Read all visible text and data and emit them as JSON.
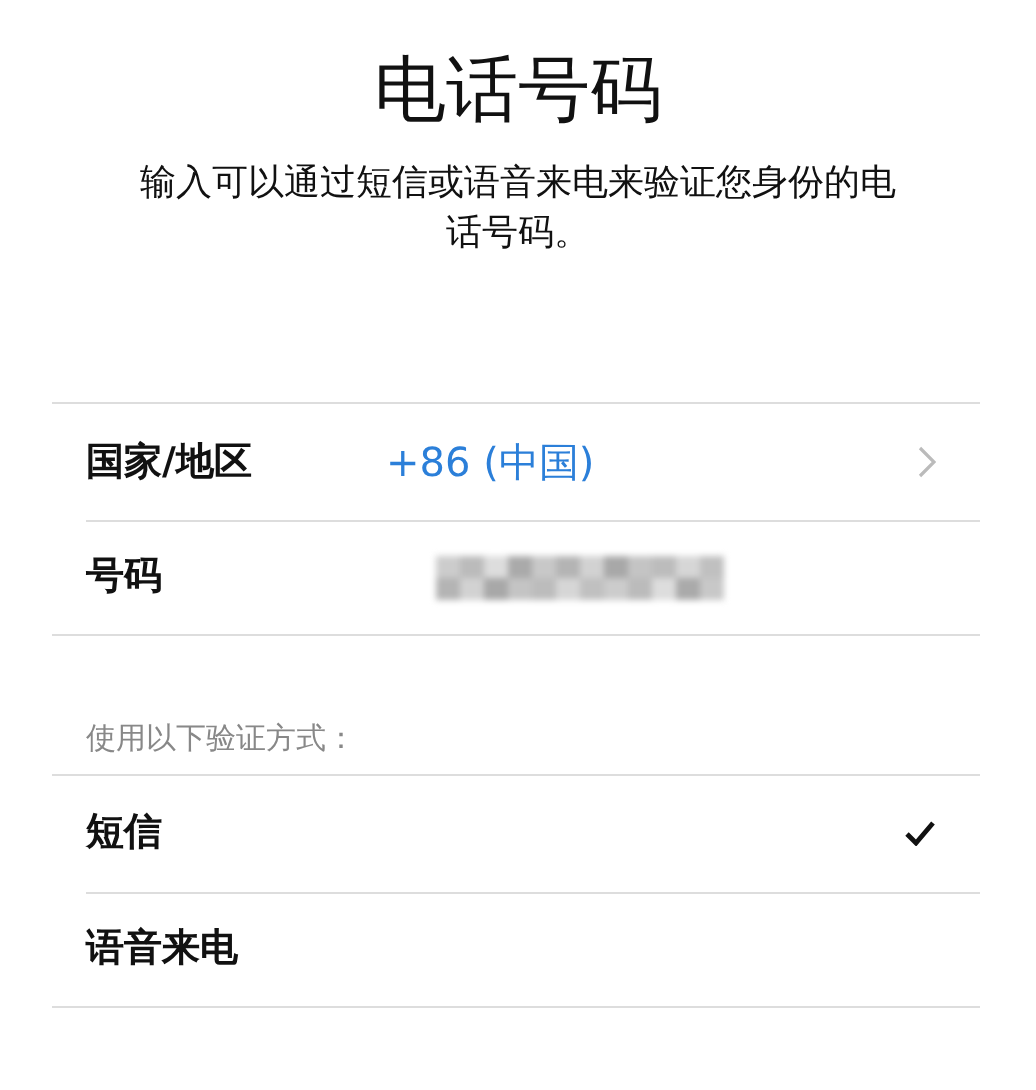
{
  "title": "电话号码",
  "description": "输入可以通过短信或语音来电来验证您身份的电话号码。",
  "fields": [
    {
      "kind": "link",
      "label": "国家/地区",
      "value": "+86 (中国)"
    },
    {
      "kind": "hidden",
      "label": "号码"
    }
  ],
  "methods_header": "使用以下验证方式：",
  "methods": [
    {
      "label": "短信",
      "selected": true
    },
    {
      "label": "语音来电",
      "selected": false
    }
  ]
}
